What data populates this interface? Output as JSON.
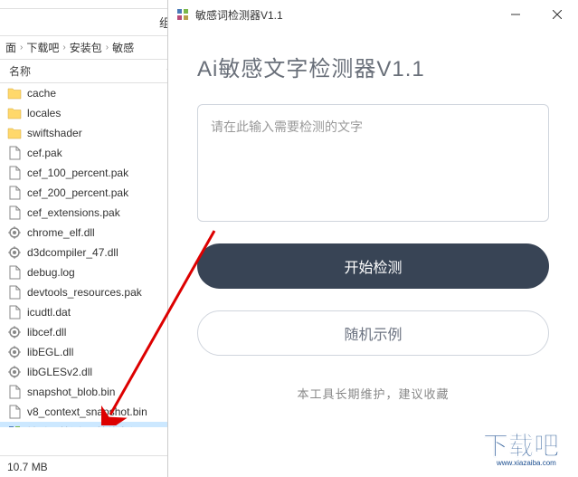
{
  "explorer": {
    "toolbar_text": "组",
    "breadcrumb": [
      "面",
      "下载吧",
      "安装包",
      "敏感"
    ],
    "column_header": "名称",
    "files": [
      {
        "name": "cache",
        "type": "folder"
      },
      {
        "name": "locales",
        "type": "folder"
      },
      {
        "name": "swiftshader",
        "type": "folder"
      },
      {
        "name": "cef.pak",
        "type": "file"
      },
      {
        "name": "cef_100_percent.pak",
        "type": "file"
      },
      {
        "name": "cef_200_percent.pak",
        "type": "file"
      },
      {
        "name": "cef_extensions.pak",
        "type": "file"
      },
      {
        "name": "chrome_elf.dll",
        "type": "dll"
      },
      {
        "name": "d3dcompiler_47.dll",
        "type": "dll"
      },
      {
        "name": "debug.log",
        "type": "file"
      },
      {
        "name": "devtools_resources.pak",
        "type": "file"
      },
      {
        "name": "icudtl.dat",
        "type": "file"
      },
      {
        "name": "libcef.dll",
        "type": "dll"
      },
      {
        "name": "libEGL.dll",
        "type": "dll"
      },
      {
        "name": "libGLESv2.dll",
        "type": "dll"
      },
      {
        "name": "snapshot_blob.bin",
        "type": "file"
      },
      {
        "name": "v8_context_snapshot.bin",
        "type": "file"
      },
      {
        "name": "敏感词检测器(其他文件不要",
        "type": "exe",
        "selected": true
      }
    ],
    "status": "10.7 MB"
  },
  "app": {
    "window_title": "敏感词检测器V1.1",
    "title": "Ai敏感文字检测器V1.1",
    "input_placeholder": "请在此输入需要检测的文字",
    "btn_start": "开始检测",
    "btn_random": "随机示例",
    "footer": "本工具长期维护，建议收藏"
  },
  "watermark": "下载吧"
}
